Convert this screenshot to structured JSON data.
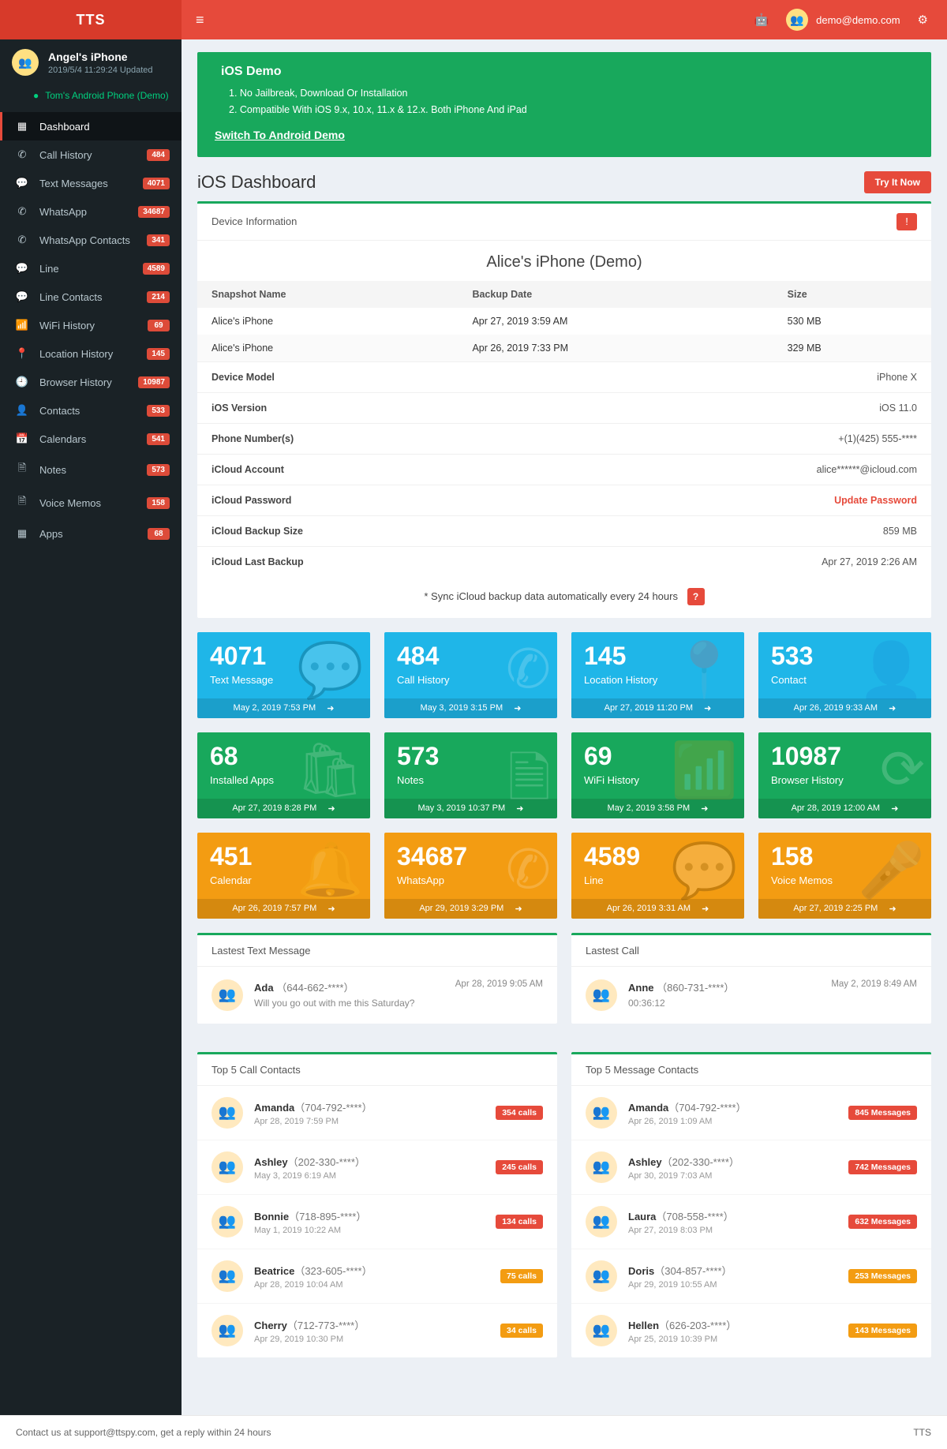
{
  "brand": "TTS",
  "user_email": "demo@demo.com",
  "device": {
    "name": "Angel's iPhone",
    "updated": "2019/5/4 11:29:24 Updated",
    "switch_label": "Tom's Android Phone (Demo)"
  },
  "menu": [
    {
      "icon": "▦",
      "label": "Dashboard",
      "active": true
    },
    {
      "icon": "✆",
      "label": "Call History",
      "badge": "484"
    },
    {
      "icon": "💬",
      "label": "Text Messages",
      "badge": "4071"
    },
    {
      "icon": "✆",
      "label": "WhatsApp",
      "badge": "34687"
    },
    {
      "icon": "✆",
      "label": "WhatsApp Contacts",
      "badge": "341"
    },
    {
      "icon": "💬",
      "label": "Line",
      "badge": "4589"
    },
    {
      "icon": "💬",
      "label": "Line Contacts",
      "badge": "214"
    },
    {
      "icon": "📶",
      "label": "WiFi History",
      "badge": "69"
    },
    {
      "icon": "📍",
      "label": "Location History",
      "badge": "145"
    },
    {
      "icon": "🕘",
      "label": "Browser History",
      "badge": "10987"
    },
    {
      "icon": "👤",
      "label": "Contacts",
      "badge": "533"
    },
    {
      "icon": "📅",
      "label": "Calendars",
      "badge": "541"
    },
    {
      "icon": "🗎",
      "label": "Notes",
      "badge": "573"
    },
    {
      "icon": "🗎",
      "label": "Voice Memos",
      "badge": "158"
    },
    {
      "icon": "▦",
      "label": "Apps",
      "badge": "68"
    }
  ],
  "banner": {
    "title": "iOS Demo",
    "line1": "1. No Jailbreak, Download Or Installation",
    "line2": "2. Compatible With iOS 9.x, 10.x, 11.x & 12.x. Both iPhone And iPad",
    "switch": "Switch To Android Demo"
  },
  "page_title": "iOS Dashboard",
  "try_btn": "Try It Now",
  "device_info": {
    "panel_title": "Device Information",
    "demo_name": "Alice's iPhone (Demo)",
    "headers": {
      "snapshot": "Snapshot Name",
      "date": "Backup Date",
      "size": "Size"
    },
    "snapshots": [
      {
        "name": "Alice's iPhone",
        "date": "Apr 27, 2019 3:59 AM",
        "size": "530 MB"
      },
      {
        "name": "Alice's iPhone",
        "date": "Apr 26, 2019 7:33 PM",
        "size": "329 MB"
      }
    ],
    "rows": [
      {
        "k": "Device Model",
        "v": "iPhone X"
      },
      {
        "k": "iOS Version",
        "v": "iOS 11.0"
      },
      {
        "k": "Phone Number(s)",
        "v": "+(1)(425) 555-****"
      },
      {
        "k": "iCloud Account",
        "v": "alice******@icloud.com"
      },
      {
        "k": "iCloud Password",
        "v": "Update Password",
        "red": true
      },
      {
        "k": "iCloud Backup Size",
        "v": "859 MB"
      },
      {
        "k": "iCloud Last Backup",
        "v": "Apr 27, 2019 2:26 AM"
      }
    ],
    "sync_note": "* Sync iCloud backup data automatically every 24 hours"
  },
  "cards": [
    {
      "n": "4071",
      "l": "Text Message",
      "t": "May 2, 2019 7:53 PM",
      "c": "c-blue",
      "i": "💬"
    },
    {
      "n": "484",
      "l": "Call History",
      "t": "May 3, 2019 3:15 PM",
      "c": "c-blue",
      "i": "✆"
    },
    {
      "n": "145",
      "l": "Location History",
      "t": "Apr 27, 2019 11:20 PM",
      "c": "c-blue",
      "i": "📍"
    },
    {
      "n": "533",
      "l": "Contact",
      "t": "Apr 26, 2019 9:33 AM",
      "c": "c-blue",
      "i": "👤"
    },
    {
      "n": "68",
      "l": "Installed Apps",
      "t": "Apr 27, 2019 8:28 PM",
      "c": "c-green",
      "i": "🛍"
    },
    {
      "n": "573",
      "l": "Notes",
      "t": "May 3, 2019 10:37 PM",
      "c": "c-green",
      "i": "🗎"
    },
    {
      "n": "69",
      "l": "WiFi History",
      "t": "May 2, 2019 3:58 PM",
      "c": "c-green",
      "i": "📶"
    },
    {
      "n": "10987",
      "l": "Browser History",
      "t": "Apr 28, 2019 12:00 AM",
      "c": "c-green",
      "i": "⟳"
    },
    {
      "n": "451",
      "l": "Calendar",
      "t": "Apr 26, 2019 7:57 PM",
      "c": "c-orange",
      "i": "🔔"
    },
    {
      "n": "34687",
      "l": "WhatsApp",
      "t": "Apr 29, 2019 3:29 PM",
      "c": "c-orange",
      "i": "✆"
    },
    {
      "n": "4589",
      "l": "Line",
      "t": "Apr 26, 2019 3:31 AM",
      "c": "c-orange",
      "i": "💬"
    },
    {
      "n": "158",
      "l": "Voice Memos",
      "t": "Apr 27, 2019 2:25 PM",
      "c": "c-orange",
      "i": "🎤"
    }
  ],
  "latest": {
    "text": {
      "title": "Lastest Text Message",
      "name": "Ada",
      "phone": "（644-662-****）",
      "body": "Will you go out with me this Saturday?",
      "time": "Apr 28, 2019 9:05 AM"
    },
    "call": {
      "title": "Lastest Call",
      "name": "Anne",
      "phone": "（860-731-****）",
      "body": "00:36:12",
      "time": "May 2, 2019 8:49 AM"
    }
  },
  "top_calls": {
    "title": "Top 5 Call Contacts",
    "suffix": "calls",
    "rows": [
      {
        "n": "Amanda",
        "p": "（704-792-****）",
        "d": "Apr 28, 2019 7:59 PM",
        "c": "354",
        "color": ""
      },
      {
        "n": "Ashley",
        "p": "（202-330-****）",
        "d": "May 3, 2019 6:19 AM",
        "c": "245",
        "color": ""
      },
      {
        "n": "Bonnie",
        "p": "（718-895-****）",
        "d": "May 1, 2019 10:22 AM",
        "c": "134",
        "color": ""
      },
      {
        "n": "Beatrice",
        "p": "（323-605-****）",
        "d": "Apr 28, 2019 10:04 AM",
        "c": "75",
        "color": "orange"
      },
      {
        "n": "Cherry",
        "p": "（712-773-****）",
        "d": "Apr 29, 2019 10:30 PM",
        "c": "34",
        "color": "orange"
      }
    ]
  },
  "top_msgs": {
    "title": "Top 5 Message Contacts",
    "suffix": "Messages",
    "rows": [
      {
        "n": "Amanda",
        "p": "（704-792-****）",
        "d": "Apr 26, 2019 1:09 AM",
        "c": "845",
        "color": ""
      },
      {
        "n": "Ashley",
        "p": "（202-330-****）",
        "d": "Apr 30, 2019 7:03 AM",
        "c": "742",
        "color": ""
      },
      {
        "n": "Laura",
        "p": "（708-558-****）",
        "d": "Apr 27, 2019 8:03 PM",
        "c": "632",
        "color": ""
      },
      {
        "n": "Doris",
        "p": "（304-857-****）",
        "d": "Apr 29, 2019 10:55 AM",
        "c": "253",
        "color": "orange"
      },
      {
        "n": "Hellen",
        "p": "（626-203-****）",
        "d": "Apr 25, 2019 10:39 PM",
        "c": "143",
        "color": "orange"
      }
    ]
  },
  "footer": {
    "left": "Contact us at support@ttspy.com, get a reply within 24 hours",
    "right": "TTS"
  }
}
